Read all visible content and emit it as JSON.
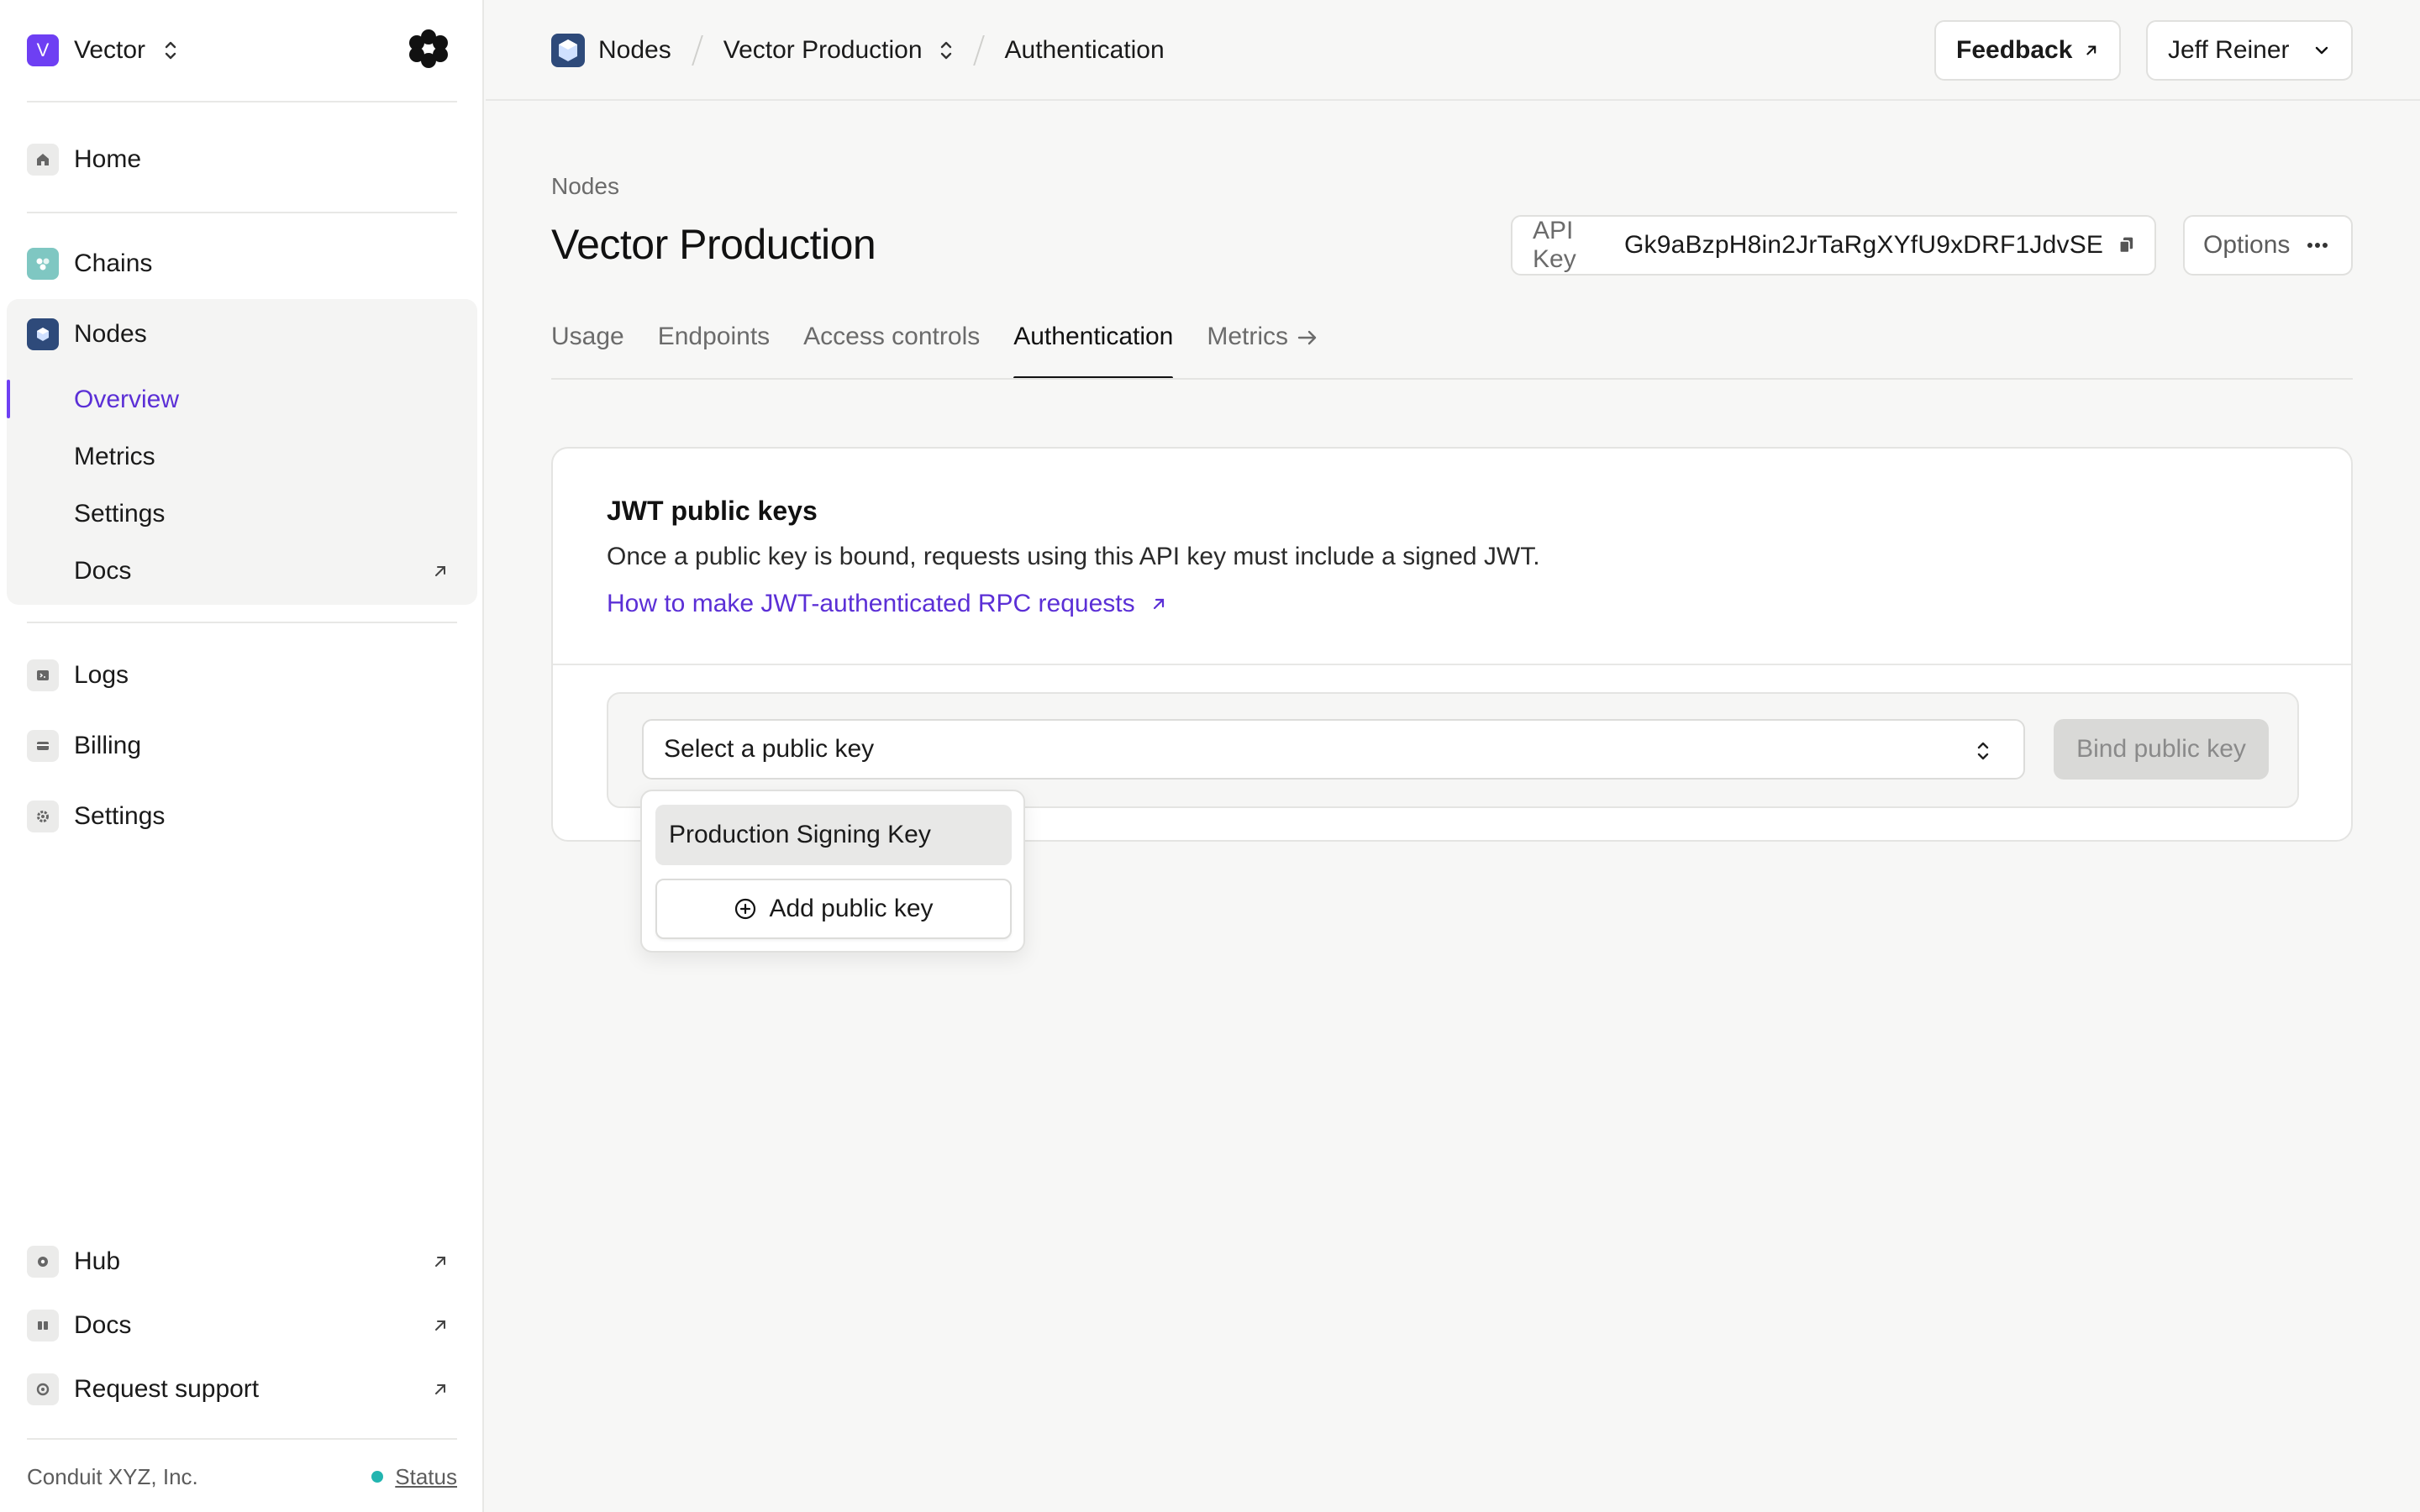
{
  "workspace": {
    "initial": "V",
    "name": "Vector"
  },
  "sidebar": {
    "home": "Home",
    "chains": "Chains",
    "nodes": "Nodes",
    "nodes_sub": {
      "overview": "Overview",
      "metrics": "Metrics",
      "settings": "Settings",
      "docs": "Docs"
    },
    "logs": "Logs",
    "billing": "Billing",
    "settings": "Settings",
    "hub": "Hub",
    "docs": "Docs",
    "support": "Request support",
    "footer": {
      "company": "Conduit XYZ, Inc.",
      "status": "Status"
    }
  },
  "breadcrumb": {
    "section": "Nodes",
    "project": "Vector Production",
    "page": "Authentication"
  },
  "header": {
    "feedback": "Feedback",
    "user": "Jeff Reiner"
  },
  "page": {
    "kicker": "Nodes",
    "title": "Vector Production",
    "api_key_label": "API Key",
    "api_key_value": "Gk9aBzpH8in2JrTaRgXYfU9xDRF1JdvSE",
    "options": "Options"
  },
  "tabs": [
    "Usage",
    "Endpoints",
    "Access controls",
    "Authentication",
    "Metrics"
  ],
  "card": {
    "title": "JWT public keys",
    "description": "Once a public key is bound, requests using this API key must include a signed JWT.",
    "link": "How to make JWT-authenticated RPC requests",
    "select_placeholder": "Select a public key",
    "bind_button": "Bind public key"
  },
  "dropdown": {
    "option": "Production Signing Key",
    "add": "Add public key"
  },
  "colors": {
    "accent": "#6e3ff3",
    "link": "#5b2fd6",
    "status": "#22b5b0"
  }
}
